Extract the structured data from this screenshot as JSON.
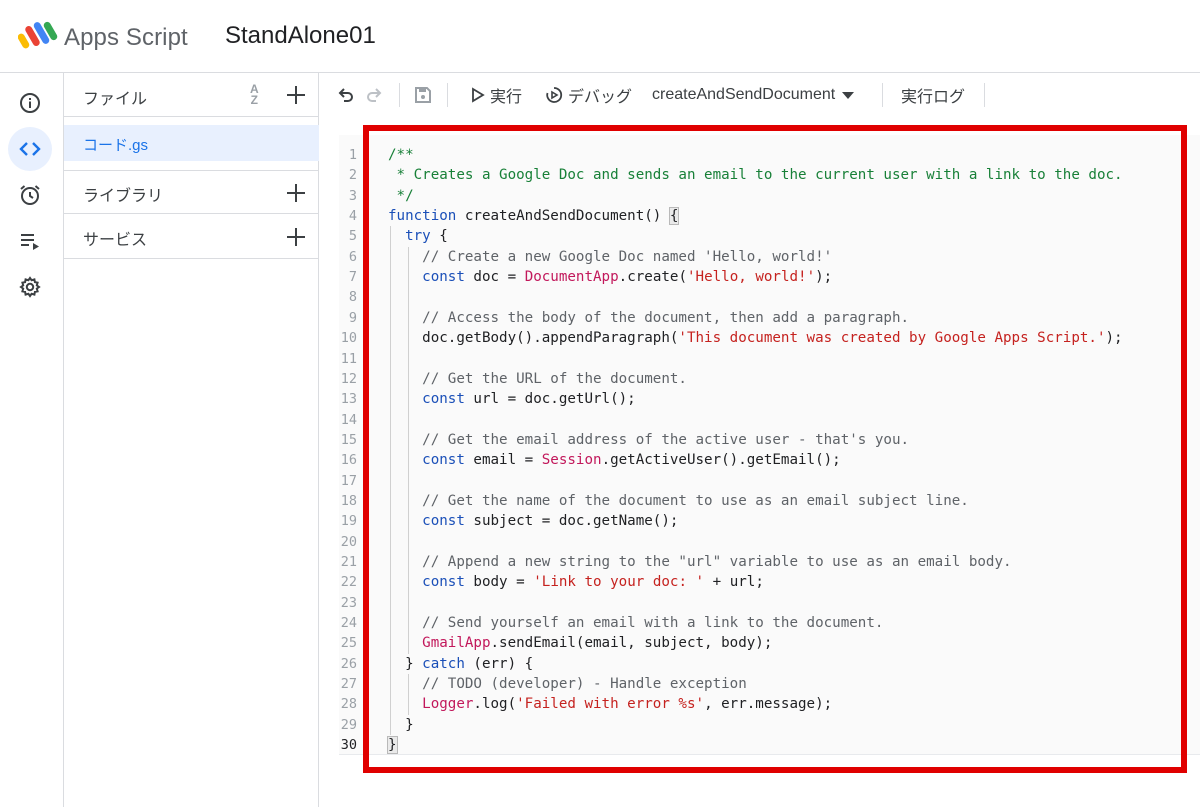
{
  "header": {
    "app_name": "Apps Script",
    "project_name": "StandAlone01"
  },
  "files_panel": {
    "title": "ファイル",
    "sort_icon": "sort-az-icon",
    "file_name": "コード.gs",
    "sections": [
      {
        "label": "ライブラリ"
      },
      {
        "label": "サービス"
      }
    ]
  },
  "toolbar": {
    "run_label": "実行",
    "debug_label": "デバッグ",
    "function_name": "createAndSendDocument",
    "log_label": "実行ログ"
  },
  "editor": {
    "current_line": 30,
    "lines": [
      "/**",
      " * Creates a Google Doc and sends an email to the current user with a link to the doc.",
      " */",
      "function createAndSendDocument() {",
      "  try {",
      "    // Create a new Google Doc named 'Hello, world!'",
      "    const doc = DocumentApp.create('Hello, world!');",
      "",
      "    // Access the body of the document, then add a paragraph.",
      "    doc.getBody().appendParagraph('This document was created by Google Apps Script.');",
      "",
      "    // Get the URL of the document.",
      "    const url = doc.getUrl();",
      "",
      "    // Get the email address of the active user - that's you.",
      "    const email = Session.getActiveUser().getEmail();",
      "",
      "    // Get the name of the document to use as an email subject line.",
      "    const subject = doc.getName();",
      "",
      "    // Append a new string to the \"url\" variable to use as an email body.",
      "    const body = 'Link to your doc: ' + url;",
      "",
      "    // Send yourself an email with a link to the document.",
      "    GmailApp.sendEmail(email, subject, body);",
      "  } catch (err) {",
      "    // TODO (developer) - Handle exception",
      "    Logger.log('Failed with error %s', err.message);",
      "  }",
      "}"
    ]
  },
  "colors": {
    "accent": "#1a73e8",
    "highlight_border": "#e00000",
    "comment": "#188038",
    "keyword": "#1a4fb8",
    "string": "#c5221f",
    "class": "#c2185b"
  }
}
